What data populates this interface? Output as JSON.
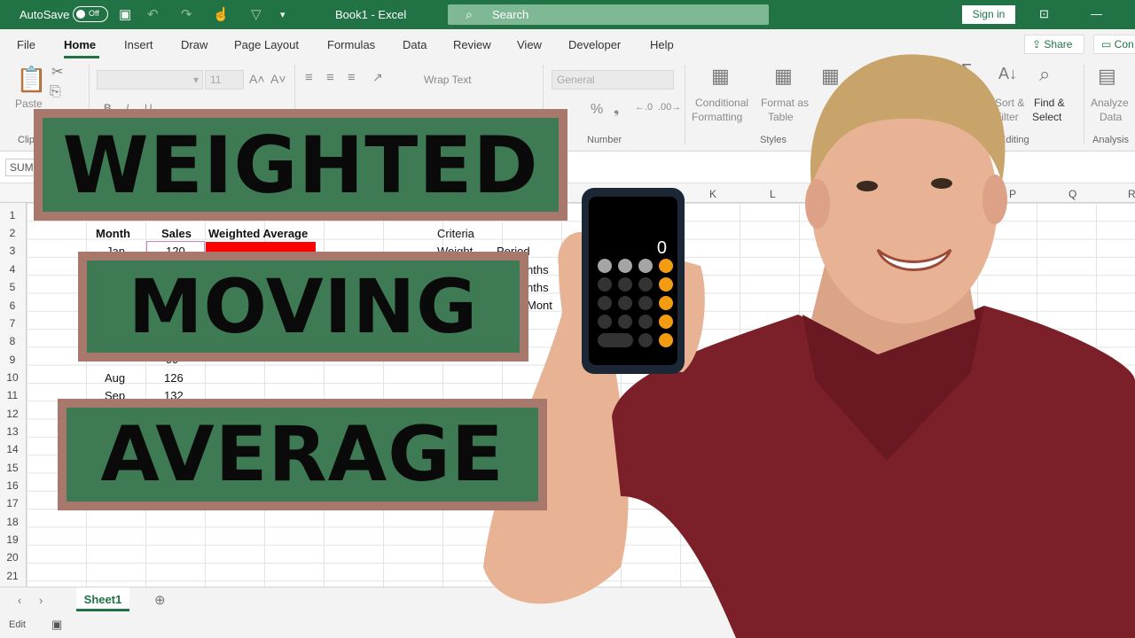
{
  "titlebar": {
    "autosave_label": "AutoSave",
    "autosave_state": "Off",
    "doc_title": "Book1  -  Excel",
    "search_placeholder": "Search",
    "signin_label": "Sign in"
  },
  "ribbon_tabs": [
    "File",
    "Home",
    "Insert",
    "Draw",
    "Page Layout",
    "Formulas",
    "Data",
    "Review",
    "View",
    "Developer",
    "Help"
  ],
  "ribbon_actions": {
    "share": "Share",
    "comments": "Con"
  },
  "ribbon": {
    "paste": "Paste",
    "clipboard": "Clip",
    "font_size": "11",
    "wrap_text": "Wrap Text",
    "number_format": "General",
    "number_group": "Number",
    "conditional_formatting": [
      "Conditional",
      "Formatting"
    ],
    "format_as_table": [
      "Format as",
      "Table"
    ],
    "styles_group": "Styles",
    "sort_filter": [
      "Sort &",
      "Filter"
    ],
    "find_select": [
      "Find &",
      "Select"
    ],
    "editing_group": "Editing",
    "analyze_data": [
      "Analyze",
      "Data"
    ],
    "analysis_group": "Analysis"
  },
  "formula_bar": {
    "name_box": "SUM"
  },
  "columns": {
    "K": "K",
    "L": "L",
    "P": "P",
    "Q": "Q",
    "R": "R"
  },
  "rows": [
    "1",
    "2",
    "3",
    "4",
    "5",
    "6",
    "7",
    "8",
    "9",
    "10",
    "11",
    "12",
    "13",
    "14",
    "15",
    "16",
    "17",
    "18",
    "19",
    "20",
    "21"
  ],
  "cells": {
    "month_header": "Month",
    "sales_header": "Sales",
    "wavg_header": "Weighted Average",
    "criteria": "Criteria",
    "weight": "Weight",
    "period": "Period",
    "jan": "Jan",
    "jan_sales": "120",
    "aug": "Aug",
    "aug_sales": "126",
    "sep": "Sep",
    "sep_sales": "132",
    "row9_sales": "99",
    "nths_1": "nths",
    "nths_2": "nths",
    "mont": "Mont"
  },
  "sheet": {
    "tab": "Sheet1"
  },
  "status": {
    "mode": "Edit"
  },
  "banner": {
    "line1": "WEIGHTED",
    "line2": "MOVING",
    "line3": "AVERAGE"
  },
  "phone": {
    "display": "0"
  },
  "colors": {
    "excel_green": "#217346",
    "banner_green": "#3e7b55",
    "banner_border": "#a9786c",
    "shirt": "#7b1f28",
    "red_cell": "#ff0000"
  }
}
